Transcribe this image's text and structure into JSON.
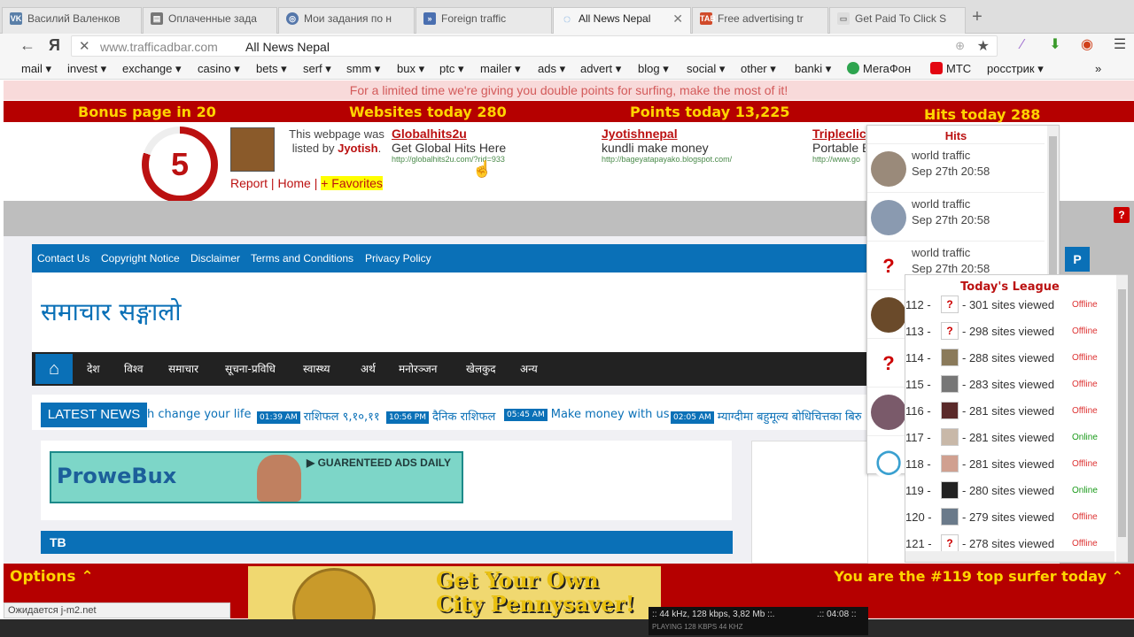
{
  "browser": {
    "tabs": [
      {
        "label": "Василий Валенков",
        "icon": "vk-icon",
        "color": "#5a7fa8"
      },
      {
        "label": "Оплаченные зада",
        "icon": "tasks-icon",
        "color": "#777"
      },
      {
        "label": "Мои задания по н",
        "icon": "target-icon",
        "color": "#5577aa"
      },
      {
        "label": "Foreign traffic",
        "icon": "shield-icon",
        "color": "#4a6fb0"
      },
      {
        "label": "All News Nepal",
        "icon": "loading-icon",
        "color": "#4a90d9"
      },
      {
        "label": "Free advertising tr",
        "icon": "tab-icon",
        "color": "#d04a2a"
      },
      {
        "label": "Get Paid To Click S",
        "icon": "page-icon",
        "color": "#999"
      }
    ],
    "url_host": "www.trafficadbar.com",
    "page_title": "All News Nepal",
    "bookmarks": [
      "mail ▾",
      "invest ▾",
      "exchange ▾",
      "casino ▾",
      "bets ▾",
      "serf ▾",
      "smm ▾",
      "bux ▾",
      "ptc ▾",
      "mailer ▾",
      "ads ▾",
      "advert ▾",
      "blog ▾",
      "social ▾",
      "other ▾",
      "banki ▾",
      "МегаФон",
      "МТС",
      "росстрик ▾"
    ],
    "bookmarks_more": "»",
    "status_text": "Ожидается j-m2.net"
  },
  "trafficbar": {
    "notice": "For a limited time we're giving you double points for surfing, make the most of it!",
    "bonus": "Bonus page in 20",
    "websites": "Websites today 280",
    "points": "Points today 13,225",
    "hits": "Hits today 288",
    "timer": "5",
    "timer_fraction": 0.8,
    "listed_prefix": "This webpage was listed by",
    "listed_user": "Jyotish",
    "report": "Report",
    "home": "Home",
    "favorites": "+ Favorites",
    "ads": [
      {
        "title": "Globalhits2u",
        "desc": "Get Global Hits Here",
        "url": "http://globalhits2u.com/?rid=933"
      },
      {
        "title": "Jyotishnepal",
        "desc": "kundli make money",
        "url": "http://bageyatapayako.blogspot.com/"
      },
      {
        "title": "Tripleclic",
        "desc": "Portable B",
        "url": "http://www.go"
      }
    ],
    "options": "Options",
    "rank": "You are the #119 top surfer today",
    "penny_line1": "Get Your Own",
    "penny_line2": "City Pennysaver!"
  },
  "hits_panel": {
    "title": "Hits",
    "items": [
      {
        "name": "world traffic",
        "time": "Sep 27th 20:58"
      },
      {
        "name": "world traffic",
        "time": "Sep 27th 20:58"
      },
      {
        "name": "world traffic",
        "time": "Sep 27th 20:58"
      }
    ]
  },
  "league": {
    "title": "Today's League",
    "rows": [
      {
        "rank": "112 -",
        "sites": "- 301 sites viewed",
        "status": "Offline"
      },
      {
        "rank": "113 -",
        "sites": "- 298 sites viewed",
        "status": "Offline"
      },
      {
        "rank": "114 -",
        "sites": "- 288 sites viewed",
        "status": "Offline"
      },
      {
        "rank": "115 -",
        "sites": "- 283 sites viewed",
        "status": "Offline"
      },
      {
        "rank": "116 -",
        "sites": "- 281 sites viewed",
        "status": "Offline"
      },
      {
        "rank": "117 -",
        "sites": "- 281 sites viewed",
        "status": "Online"
      },
      {
        "rank": "118 -",
        "sites": "- 281 sites viewed",
        "status": "Offline"
      },
      {
        "rank": "119 -",
        "sites": "- 280 sites viewed",
        "status": "Online"
      },
      {
        "rank": "120 -",
        "sites": "- 279 sites viewed",
        "status": "Offline"
      },
      {
        "rank": "121 -",
        "sites": "- 278 sites viewed",
        "status": "Offline"
      }
    ]
  },
  "site": {
    "top_menu": [
      "Contact Us",
      "Copyright Notice",
      "Disclaimer",
      "Terms and Conditions",
      "Privacy Policy"
    ],
    "title": "समाचार सङ्गालो",
    "nav": [
      "देश",
      "विश्व",
      "समाचार",
      "सूचना-प्रविधि",
      "स्वास्थ्य",
      "अर्थ",
      "मनोरञ्जन",
      "खेलकुद",
      "अन्य"
    ],
    "latest_label": "LATEST NEWS",
    "ticker": [
      {
        "time": "",
        "text": "h change your life"
      },
      {
        "time": "01:39 AM",
        "text": "राशिफल ९,१०,११"
      },
      {
        "time": "10:56 PM",
        "text": "दैनिक राशिफल"
      },
      {
        "time": "05:45 AM",
        "text": "Make money with us"
      },
      {
        "time": "02:05 AM",
        "text": "म्याग्दीमा बहुमूल्य बोधिचित्तका बिरु"
      }
    ],
    "ad_logo": "ProweBux",
    "ad_tag": "GUARENTEED ADS DAILY",
    "section_title": "TB"
  },
  "player": {
    "info": ":: 44 kHz, 128 kbps, 3,82 Mb ::.",
    "time": ".:: 04:08 ::",
    "labels": "PLAYING   128 KBPS   44 KHZ"
  }
}
